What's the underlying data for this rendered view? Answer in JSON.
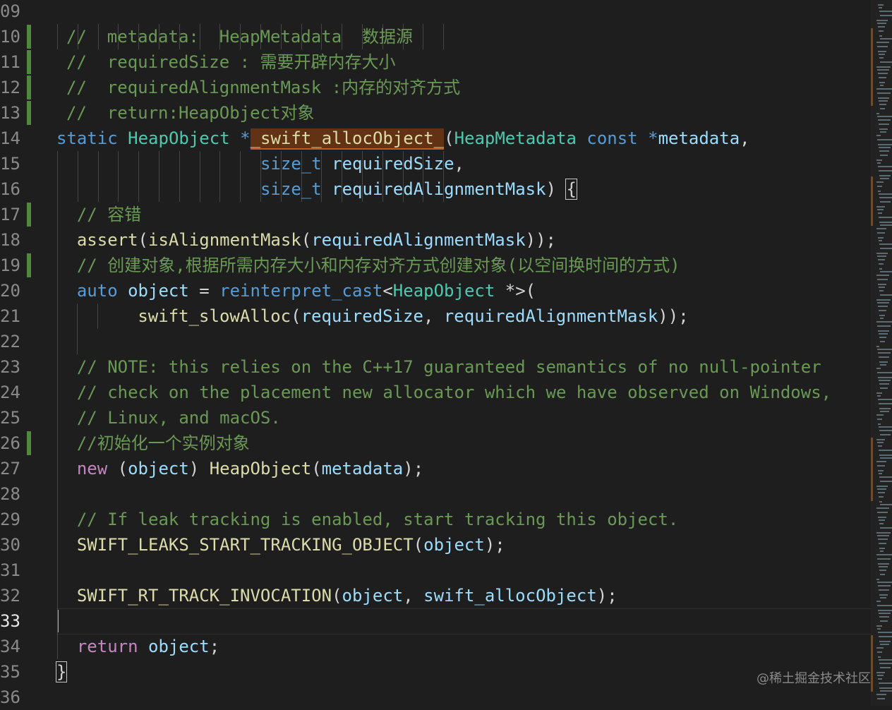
{
  "editor": {
    "lines": [
      {
        "num": "09",
        "tokens": []
      },
      {
        "num": "10",
        "mark": true,
        "tokens": [
          {
            "t": "// ",
            "c": "com"
          },
          {
            "t": " metadata:  HeapMetadata  数据源",
            "c": "com"
          }
        ],
        "guides": []
      },
      {
        "num": "11",
        "mark": true,
        "tokens": [
          {
            "t": "// ",
            "c": "com"
          },
          {
            "t": " requiredSize : 需要开辟内存大小",
            "c": "com"
          }
        ]
      },
      {
        "num": "12",
        "mark": true,
        "tokens": [
          {
            "t": "// ",
            "c": "com"
          },
          {
            "t": " requiredAlignmentMask :内存的对齐方式",
            "c": "com"
          }
        ]
      },
      {
        "num": "13",
        "mark": true,
        "tokens": [
          {
            "t": "// ",
            "c": "com"
          },
          {
            "t": " return:HeapObject对象",
            "c": "com"
          }
        ]
      },
      {
        "num": "14",
        "tokens": [
          {
            "t": "static ",
            "c": "kw"
          },
          {
            "t": "HeapObject ",
            "c": "type"
          },
          {
            "t": "*",
            "c": "kw"
          },
          {
            "t": "_swift_allocObject_",
            "c": "fn hl"
          },
          {
            "t": "(",
            "c": ""
          },
          {
            "t": "HeapMetadata ",
            "c": "type"
          },
          {
            "t": "const ",
            "c": "kw"
          },
          {
            "t": "*",
            "c": "kw"
          },
          {
            "t": "metadata",
            "c": "var"
          },
          {
            "t": ",",
            "c": ""
          }
        ]
      },
      {
        "num": "15",
        "guides": 10,
        "tokens": [
          {
            "t": "                    ",
            "c": ""
          },
          {
            "t": "size_t ",
            "c": "kw"
          },
          {
            "t": "requiredSize",
            "c": "var"
          },
          {
            "t": ",",
            "c": ""
          }
        ]
      },
      {
        "num": "16",
        "guides": 10,
        "tokens": [
          {
            "t": "                    ",
            "c": ""
          },
          {
            "t": "size_t ",
            "c": "kw"
          },
          {
            "t": "requiredAlignmentMask",
            "c": "var"
          },
          {
            "t": ") ",
            "c": ""
          },
          {
            "t": "{",
            "c": "brace"
          }
        ]
      },
      {
        "num": "17",
        "mark": true,
        "tokens": [
          {
            "t": " ",
            "c": ""
          },
          {
            "t": "// 容错",
            "c": "com"
          }
        ]
      },
      {
        "num": "18",
        "tokens": [
          {
            "t": " ",
            "c": ""
          },
          {
            "t": "assert",
            "c": "fn"
          },
          {
            "t": "(",
            "c": ""
          },
          {
            "t": "isAlignmentMask",
            "c": "fn"
          },
          {
            "t": "(",
            "c": ""
          },
          {
            "t": "requiredAlignmentMask",
            "c": "var"
          },
          {
            "t": "));",
            "c": ""
          }
        ]
      },
      {
        "num": "19",
        "mark": true,
        "tokens": [
          {
            "t": " ",
            "c": ""
          },
          {
            "t": "// 创建对象,根据所需内存大小和内存对齐方式创建对象(以空间换时间的方式)",
            "c": "com"
          }
        ]
      },
      {
        "num": "20",
        "tokens": [
          {
            "t": " ",
            "c": ""
          },
          {
            "t": "auto ",
            "c": "kw"
          },
          {
            "t": "object",
            "c": "var"
          },
          {
            "t": " = ",
            "c": ""
          },
          {
            "t": "reinterpret_cast",
            "c": "kw"
          },
          {
            "t": "<",
            "c": ""
          },
          {
            "t": "HeapObject",
            "c": "type"
          },
          {
            "t": " *>(",
            "c": ""
          }
        ]
      },
      {
        "num": "21",
        "guides2": true,
        "tokens": [
          {
            "t": "   ",
            "c": ""
          },
          {
            "t": "swift_slowAlloc",
            "c": "fn"
          },
          {
            "t": "(",
            "c": ""
          },
          {
            "t": "requiredSize",
            "c": "var"
          },
          {
            "t": ", ",
            "c": ""
          },
          {
            "t": "requiredAlignmentMask",
            "c": "var"
          },
          {
            "t": "));",
            "c": ""
          }
        ]
      },
      {
        "num": "22",
        "guides1": true,
        "tokens": []
      },
      {
        "num": "23",
        "tokens": [
          {
            "t": " ",
            "c": ""
          },
          {
            "t": "// NOTE: this relies on the C++17 guaranteed semantics of no null-pointer",
            "c": "com"
          }
        ]
      },
      {
        "num": "24",
        "tokens": [
          {
            "t": " ",
            "c": ""
          },
          {
            "t": "// check on the placement new allocator which we have observed on Windows,",
            "c": "com"
          }
        ]
      },
      {
        "num": "25",
        "tokens": [
          {
            "t": " ",
            "c": ""
          },
          {
            "t": "// Linux, and macOS.",
            "c": "com"
          }
        ]
      },
      {
        "num": "26",
        "mark": true,
        "tokens": [
          {
            "t": " ",
            "c": ""
          },
          {
            "t": "//初始化一个实例对象",
            "c": "com"
          }
        ]
      },
      {
        "num": "27",
        "tokens": [
          {
            "t": " ",
            "c": ""
          },
          {
            "t": "new ",
            "c": "ctl"
          },
          {
            "t": "(",
            "c": ""
          },
          {
            "t": "object",
            "c": "var"
          },
          {
            "t": ") ",
            "c": ""
          },
          {
            "t": "HeapObject",
            "c": "fn"
          },
          {
            "t": "(",
            "c": ""
          },
          {
            "t": "metadata",
            "c": "var"
          },
          {
            "t": ");",
            "c": ""
          }
        ]
      },
      {
        "num": "28",
        "tokens": []
      },
      {
        "num": "29",
        "tokens": [
          {
            "t": " ",
            "c": ""
          },
          {
            "t": "// If leak tracking is enabled, start tracking this object.",
            "c": "com"
          }
        ]
      },
      {
        "num": "30",
        "tokens": [
          {
            "t": " ",
            "c": ""
          },
          {
            "t": "SWIFT_LEAKS_START_TRACKING_OBJECT",
            "c": "mac"
          },
          {
            "t": "(",
            "c": ""
          },
          {
            "t": "object",
            "c": "var"
          },
          {
            "t": ");",
            "c": ""
          }
        ]
      },
      {
        "num": "31",
        "tokens": []
      },
      {
        "num": "32",
        "tokens": [
          {
            "t": " ",
            "c": ""
          },
          {
            "t": "SWIFT_RT_TRACK_INVOCATION",
            "c": "mac"
          },
          {
            "t": "(",
            "c": ""
          },
          {
            "t": "object",
            "c": "var"
          },
          {
            "t": ", ",
            "c": ""
          },
          {
            "t": "swift_allocObject",
            "c": "var"
          },
          {
            "t": ");",
            "c": ""
          }
        ]
      },
      {
        "num": "33",
        "current": true,
        "tokens": []
      },
      {
        "num": "34",
        "tokens": [
          {
            "t": " ",
            "c": ""
          },
          {
            "t": "return ",
            "c": "ctl"
          },
          {
            "t": "object",
            "c": "var"
          },
          {
            "t": ";",
            "c": ""
          }
        ]
      },
      {
        "num": "35",
        "tokens": [
          {
            "t": "}",
            "c": "brace"
          }
        ]
      },
      {
        "num": "36",
        "tokens": []
      }
    ]
  },
  "watermark": "@稀土掘金技术社区",
  "colors": {
    "background": "#1e1e1e",
    "comment": "#6a9955",
    "keyword": "#569cd6",
    "type": "#4ec9b0",
    "function": "#dcdcaa",
    "variable": "#9cdcfe",
    "control": "#c586c0",
    "gutter_modified": "#4e8a3c"
  }
}
